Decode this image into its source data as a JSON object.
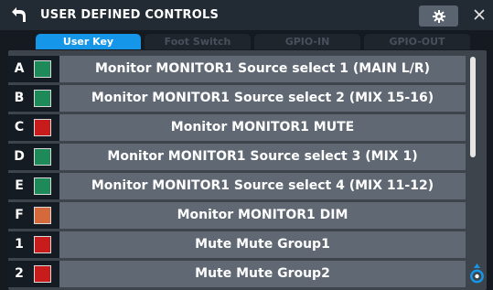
{
  "header": {
    "title": "USER DEFINED CONTROLS",
    "back_icon": "back-arrow-icon",
    "settings_icon": "gear-icon",
    "close_icon": "close-icon"
  },
  "tabs": [
    {
      "label": "User Key",
      "active": true
    },
    {
      "label": "Foot Switch",
      "active": false
    },
    {
      "label": "GPIO-IN",
      "active": false
    },
    {
      "label": "GPIO-OUT",
      "active": false
    }
  ],
  "rows": [
    {
      "key": "A",
      "color": "#1e8a5a",
      "label": "Monitor MONITOR1 Source select 1 (MAIN L/R)"
    },
    {
      "key": "B",
      "color": "#1e8a5a",
      "label": "Monitor MONITOR1 Source select 2 (MIX 15-16)"
    },
    {
      "key": "C",
      "color": "#c81c1c",
      "label": "Monitor MONITOR1 MUTE"
    },
    {
      "key": "D",
      "color": "#1e8a5a",
      "label": "Monitor MONITOR1 Source select 3 (MIX 1)"
    },
    {
      "key": "E",
      "color": "#1e8a5a",
      "label": "Monitor MONITOR1 Source select 4 (MIX 11-12)"
    },
    {
      "key": "F",
      "color": "#d46a3c",
      "label": "Monitor MONITOR1 DIM"
    },
    {
      "key": "1",
      "color": "#c81c1c",
      "label": "Mute Mute Group1"
    },
    {
      "key": "2",
      "color": "#c81c1c",
      "label": "Mute Mute Group2"
    }
  ],
  "colors": {
    "accent": "#1596e8",
    "background": "#141a20",
    "button": "#5f6873"
  }
}
